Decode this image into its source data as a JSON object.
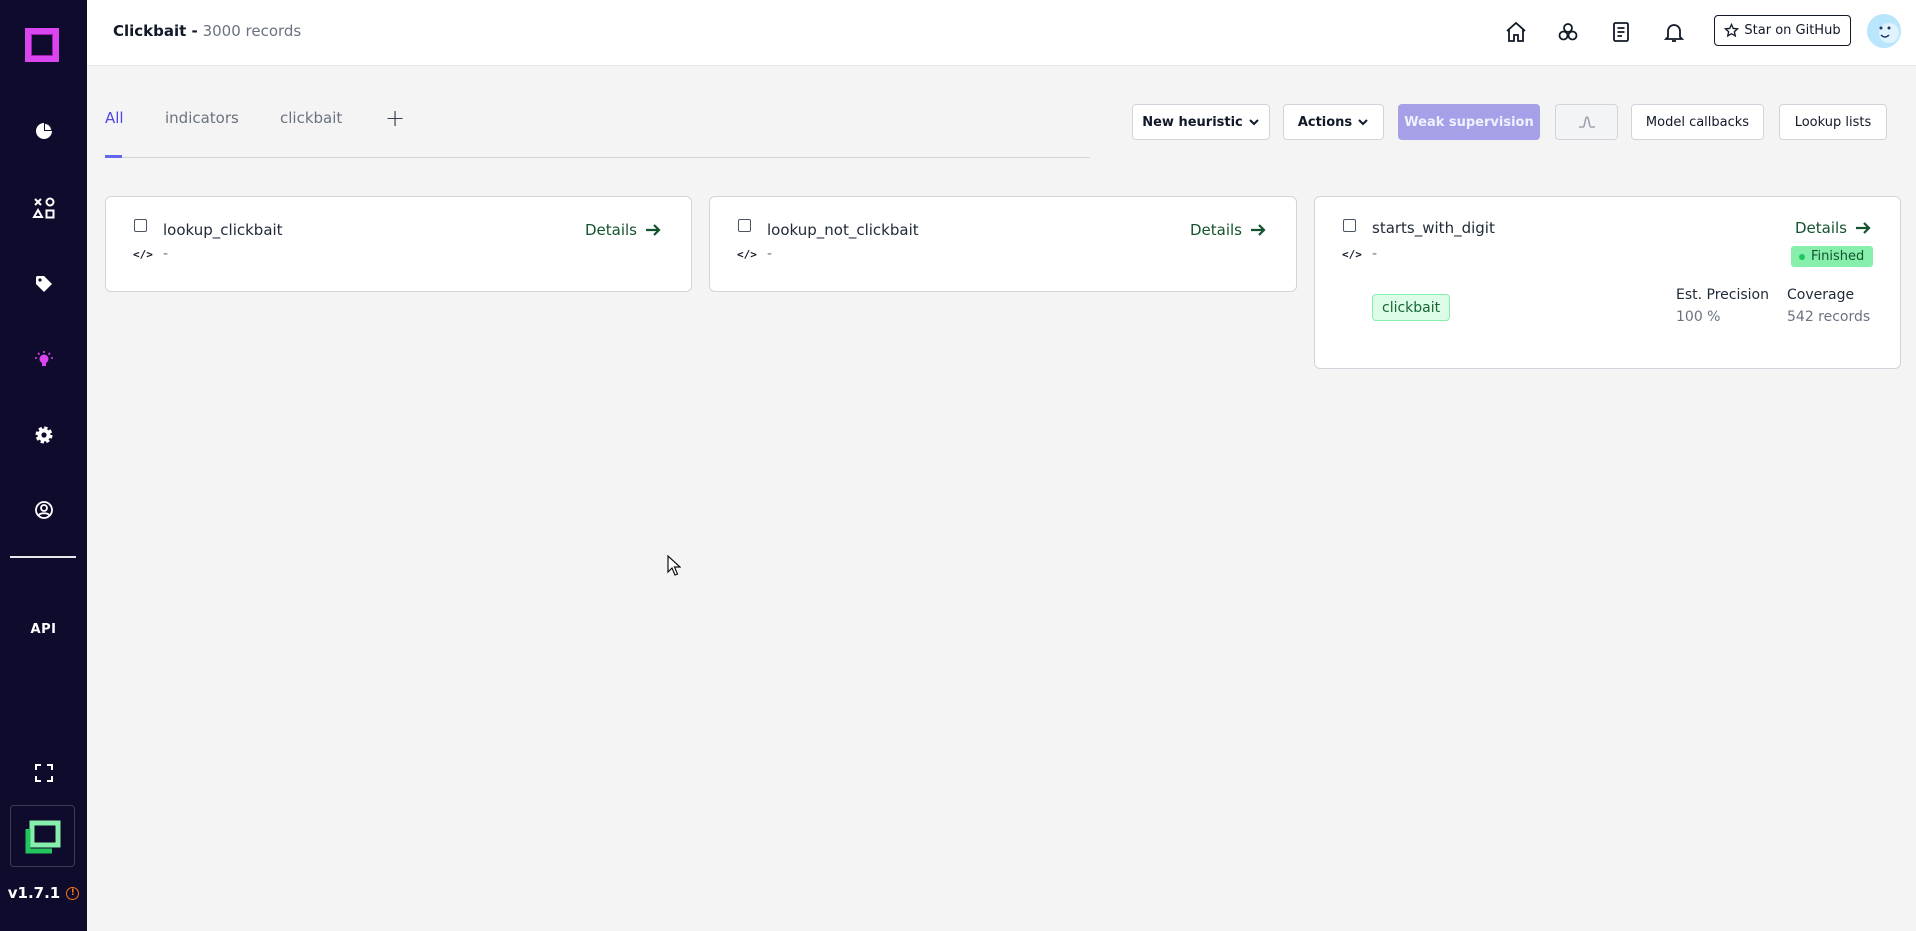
{
  "header": {
    "project_name": "Clickbait -",
    "record_count": "3000 records",
    "github_label": "Star on GitHub"
  },
  "sidebar": {
    "api_label": "API",
    "version": "v1.7.1"
  },
  "tabs": {
    "items": [
      {
        "label": "All",
        "active": true
      },
      {
        "label": "indicators",
        "active": false
      },
      {
        "label": "clickbait",
        "active": false
      }
    ],
    "add_label": "+"
  },
  "toolbar": {
    "new_heuristic": "New heuristic",
    "actions": "Actions",
    "weak_supervision": "Weak supervision",
    "model_callbacks": "Model callbacks",
    "lookup_lists": "Lookup lists"
  },
  "cards": [
    {
      "name": "lookup_clickbait",
      "description": "-",
      "details": "Details"
    },
    {
      "name": "lookup_not_clickbait",
      "description": "-",
      "details": "Details"
    },
    {
      "name": "starts_with_digit",
      "description": "-",
      "details": "Details",
      "status": "Finished",
      "label": "clickbait",
      "precision_label": "Est. Precision",
      "precision_value": "100 %",
      "coverage_label": "Coverage",
      "coverage_value": "542 records"
    }
  ],
  "colors": {
    "sidebar_bg": "#0f0b2d",
    "accent": "#6366f1",
    "primary_button": "#a5a0e8",
    "success": "#86efac"
  }
}
